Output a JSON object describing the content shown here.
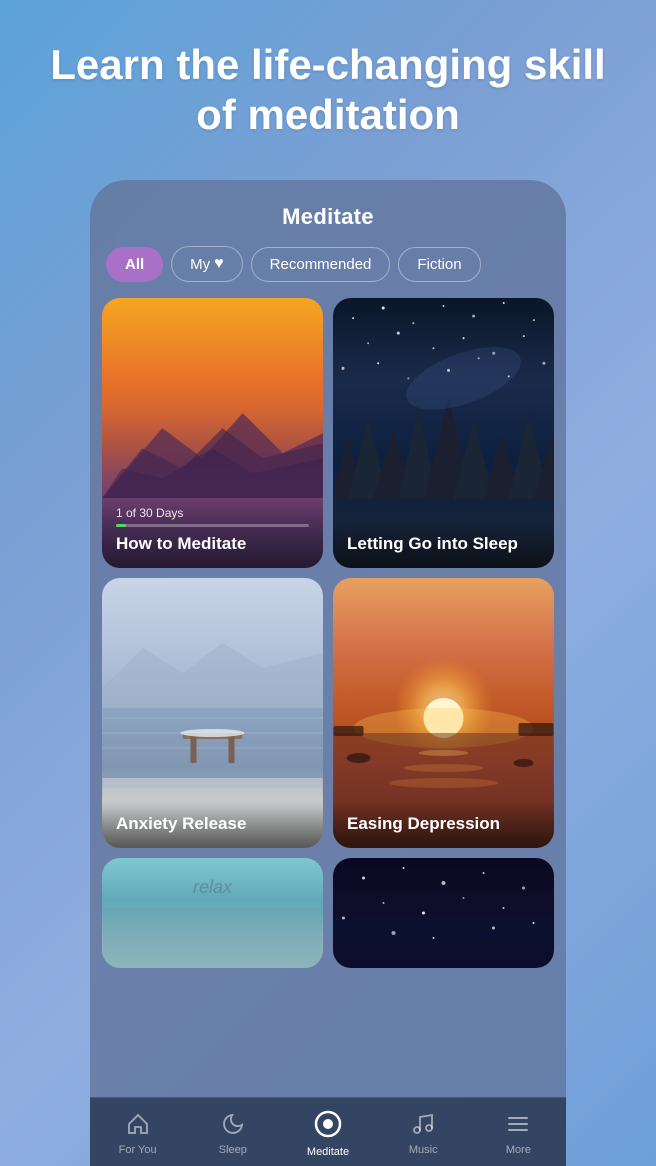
{
  "hero": {
    "title": "Learn the life-changing skill of meditation"
  },
  "app": {
    "title": "Meditate",
    "filters": [
      {
        "id": "all",
        "label": "All",
        "active": true
      },
      {
        "id": "my",
        "label": "My",
        "hasHeart": true
      },
      {
        "id": "recommended",
        "label": "Recommended",
        "active": false
      },
      {
        "id": "fiction",
        "label": "Fiction",
        "active": false
      }
    ],
    "cards": [
      {
        "id": "how-to-meditate",
        "title": "How to Meditate",
        "progress_text": "1 of 30 Days",
        "progress_pct": 5,
        "has_progress": true
      },
      {
        "id": "letting-go-into-sleep",
        "title": "Letting Go into Sleep",
        "has_progress": false
      },
      {
        "id": "anxiety-release",
        "title": "Anxiety Release",
        "has_progress": false
      },
      {
        "id": "easing-depression",
        "title": "Easing Depression",
        "has_progress": false
      }
    ]
  },
  "nav": {
    "items": [
      {
        "id": "for-you",
        "label": "For You",
        "icon": "home"
      },
      {
        "id": "sleep",
        "label": "Sleep",
        "icon": "moon"
      },
      {
        "id": "meditate",
        "label": "Meditate",
        "icon": "circle",
        "active": true
      },
      {
        "id": "music",
        "label": "Music",
        "icon": "music"
      },
      {
        "id": "more",
        "label": "More",
        "icon": "menu"
      }
    ]
  }
}
